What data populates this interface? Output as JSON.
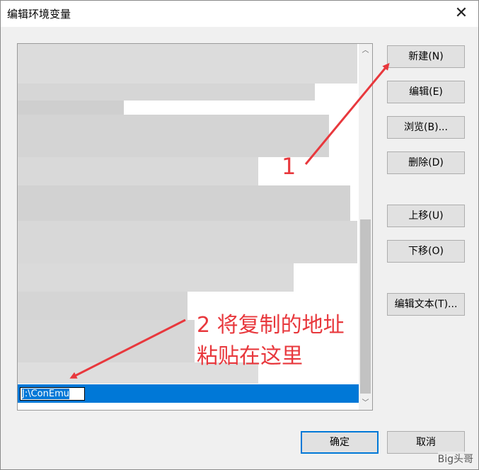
{
  "window": {
    "title": "编辑环境变量",
    "close_glyph": "✕"
  },
  "list": {
    "selected_value": "J:\\ConEmu",
    "scroll_up_glyph": "︿",
    "scroll_down_glyph": "﹀"
  },
  "buttons": {
    "new": "新建(N)",
    "edit": "编辑(E)",
    "browse": "浏览(B)...",
    "delete": "删除(D)",
    "move_up": "上移(U)",
    "move_down": "下移(O)",
    "edit_text": "编辑文本(T)...",
    "ok": "确定",
    "cancel": "取消"
  },
  "annotations": {
    "step1": "1",
    "step2_line1": "2 将复制的地址",
    "step2_line2": "粘贴在这里",
    "color": "#e8383d"
  },
  "watermark": "Big头哥",
  "colors": {
    "selection": "#0078d7",
    "background": "#f0f0f0"
  }
}
